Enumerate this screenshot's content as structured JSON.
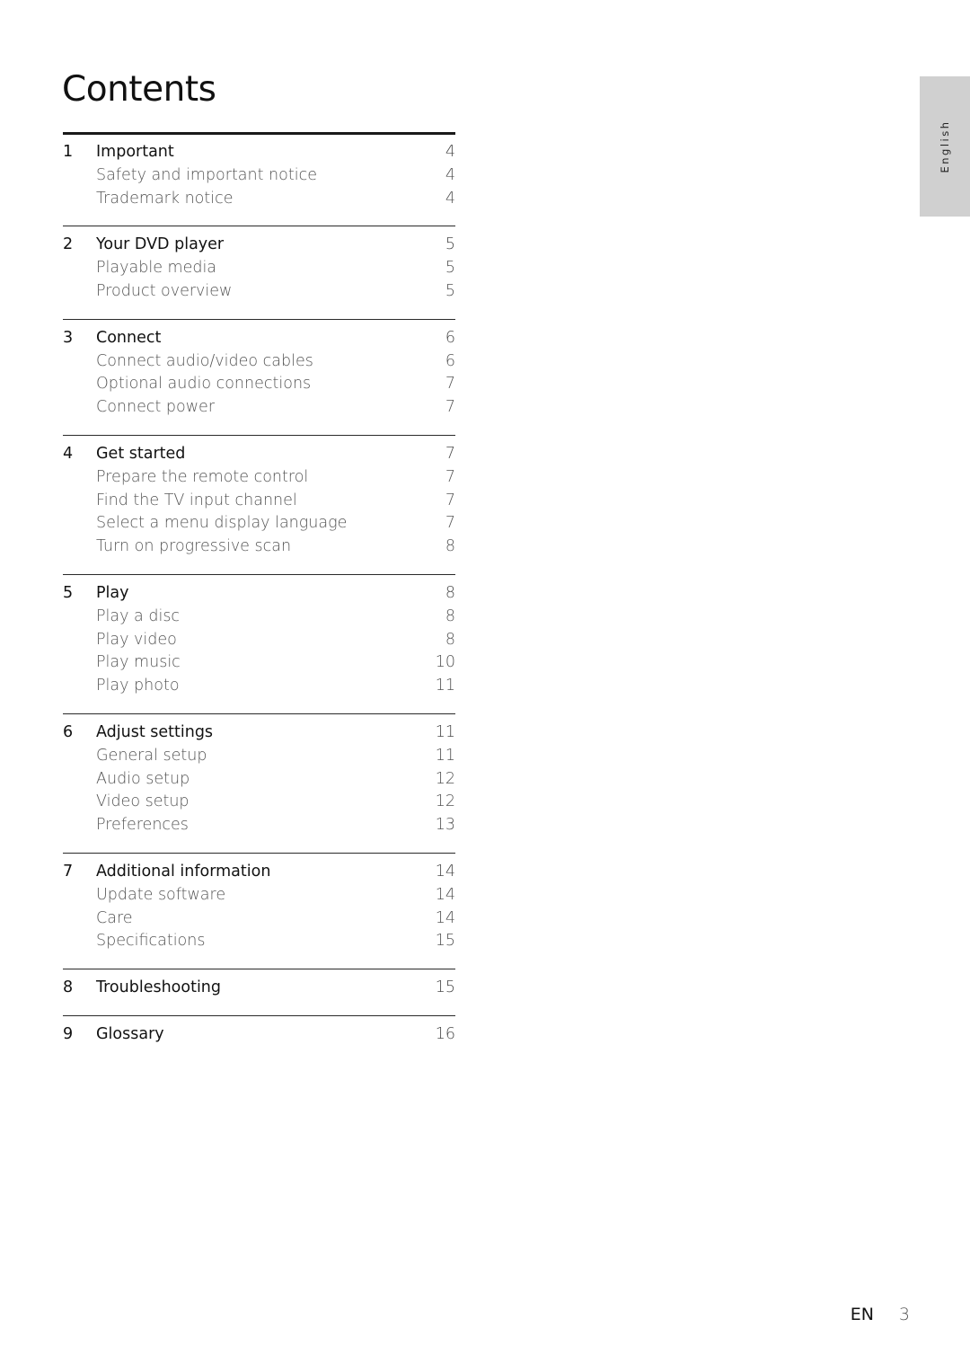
{
  "page": {
    "title": "Contents",
    "language_tab": "English",
    "footer": {
      "lang_code": "EN",
      "page_number": "3"
    }
  },
  "toc": [
    {
      "number": "1",
      "title": "Important",
      "page": "4",
      "items": [
        {
          "title": "Safety and important notice",
          "page": "4"
        },
        {
          "title": "Trademark notice",
          "page": "4"
        }
      ]
    },
    {
      "number": "2",
      "title": "Your DVD player",
      "page": "5",
      "items": [
        {
          "title": "Playable media",
          "page": "5"
        },
        {
          "title": "Product overview",
          "page": "5"
        }
      ]
    },
    {
      "number": "3",
      "title": "Connect",
      "page": "6",
      "items": [
        {
          "title": "Connect audio/video cables",
          "page": "6"
        },
        {
          "title": "Optional audio connections",
          "page": "7"
        },
        {
          "title": "Connect power",
          "page": "7"
        }
      ]
    },
    {
      "number": "4",
      "title": "Get started",
      "page": "7",
      "items": [
        {
          "title": "Prepare the remote control",
          "page": "7"
        },
        {
          "title": "Find the TV input channel",
          "page": "7"
        },
        {
          "title": "Select a menu display language",
          "page": "7"
        },
        {
          "title": "Turn on progressive scan",
          "page": "8"
        }
      ]
    },
    {
      "number": "5",
      "title": "Play",
      "page": "8",
      "items": [
        {
          "title": "Play a disc",
          "page": "8"
        },
        {
          "title": "Play video",
          "page": "8"
        },
        {
          "title": "Play music",
          "page": "10"
        },
        {
          "title": "Play photo",
          "page": "11"
        }
      ]
    },
    {
      "number": "6",
      "title": "Adjust settings",
      "page": "11",
      "items": [
        {
          "title": "General setup",
          "page": "11"
        },
        {
          "title": "Audio setup",
          "page": "12"
        },
        {
          "title": "Video setup",
          "page": "12"
        },
        {
          "title": "Preferences",
          "page": "13"
        }
      ]
    },
    {
      "number": "7",
      "title": "Additional information",
      "page": "14",
      "items": [
        {
          "title": "Update software",
          "page": "14"
        },
        {
          "title": "Care",
          "page": "14"
        },
        {
          "title": "Specifications",
          "page": "15"
        }
      ]
    },
    {
      "number": "8",
      "title": "Troubleshooting",
      "page": "15",
      "items": []
    },
    {
      "number": "9",
      "title": "Glossary",
      "page": "16",
      "items": []
    }
  ]
}
